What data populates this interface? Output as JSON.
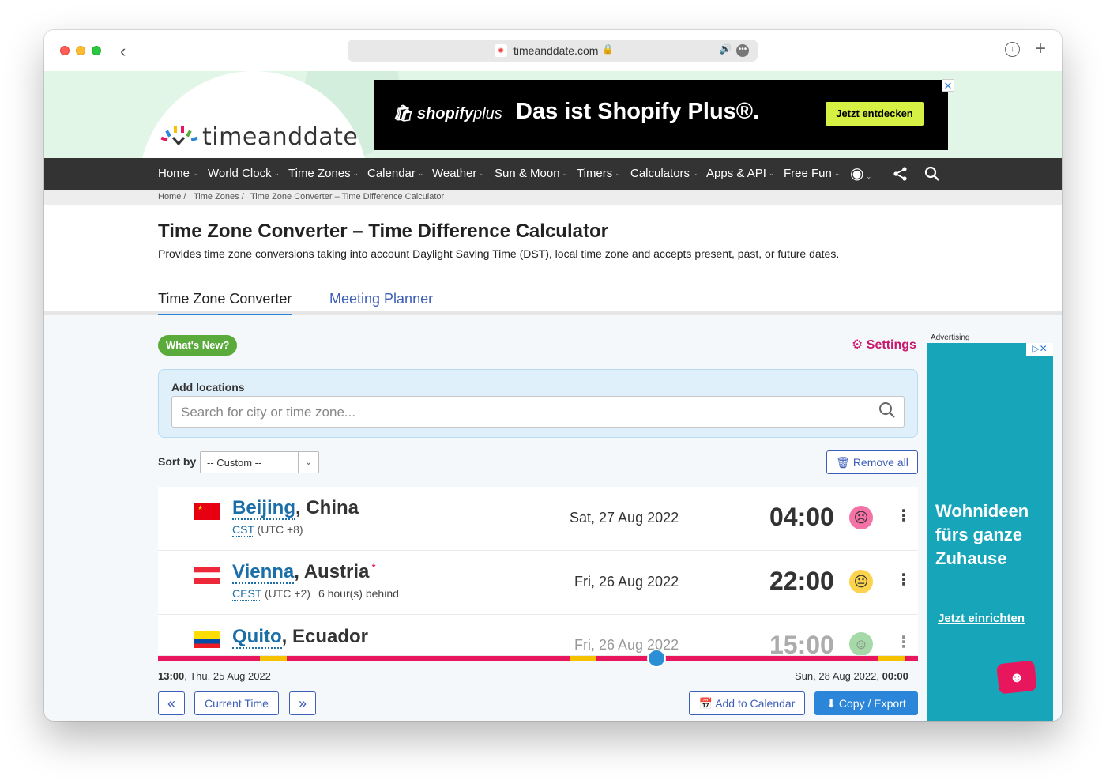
{
  "browser": {
    "url": "timeanddate.com"
  },
  "header": {
    "logo_text": "timeanddate",
    "ad": {
      "brand": "shopify",
      "brand_suffix": "plus",
      "headline": "Das ist  Shopify Plus®.",
      "cta": "Jetzt entdecken"
    }
  },
  "nav": {
    "items": [
      "Home",
      "World Clock",
      "Time Zones",
      "Calendar",
      "Weather",
      "Sun & Moon",
      "Timers",
      "Calculators",
      "Apps & API",
      "Free Fun"
    ]
  },
  "breadcrumb": [
    "Home /",
    "Time Zones /",
    "Time Zone Converter – Time Difference Calculator"
  ],
  "page": {
    "title": "Time Zone Converter – Time Difference Calculator",
    "description": "Provides time zone conversions taking into account Daylight Saving Time (DST), local time zone and accepts present, past, or future dates.",
    "tabs": [
      "Time Zone Converter",
      "Meeting Planner"
    ]
  },
  "tools": {
    "whats_new": "What's New?",
    "settings": "Settings",
    "add_label": "Add locations",
    "search_placeholder": "Search for city or time zone...",
    "sort_label": "Sort by",
    "sort_value": "-- Custom --",
    "remove_all": "Remove all"
  },
  "locations": [
    {
      "city": "Beijing",
      "country": ", China",
      "abbr": "CST",
      "utc": " (UTC +8)",
      "behind": "",
      "date": "Sat, 27 Aug 2022",
      "time": "04:00",
      "face": "☹"
    },
    {
      "city": "Vienna",
      "country": ", Austria",
      "abbr": "CEST",
      "utc": " (UTC +2)",
      "behind": "6 hour(s) behind",
      "date": "Fri, 26 Aug 2022",
      "time": "22:00",
      "face": "😐"
    },
    {
      "city": "Quito",
      "country": ", Ecuador",
      "abbr": "",
      "utc": "",
      "behind": "",
      "date": "Fri, 26 Aug 2022",
      "time": "15:00",
      "face": "☺"
    }
  ],
  "timeline": {
    "start_time": "13:00",
    "start_date": ", Thu, 25 Aug 2022",
    "end_date": "Sun, 28 Aug 2022, ",
    "end_time": "00:00",
    "position_fraction": 0.656
  },
  "buttons": {
    "prev": "«",
    "current": "Current Time",
    "next": "»",
    "add_calendar": "Add to Calendar",
    "copy_export": "Copy / Export"
  },
  "side_ad": {
    "label": "Advertising",
    "headline": "Wohnideen fürs ganze Zuhause",
    "link": "Jetzt einrichten"
  },
  "colors": {
    "accent": "#2b85d8",
    "timeline": "#e8175d",
    "settings": "#c8186c",
    "nav": "#333333",
    "ad": "#17a5b9"
  }
}
